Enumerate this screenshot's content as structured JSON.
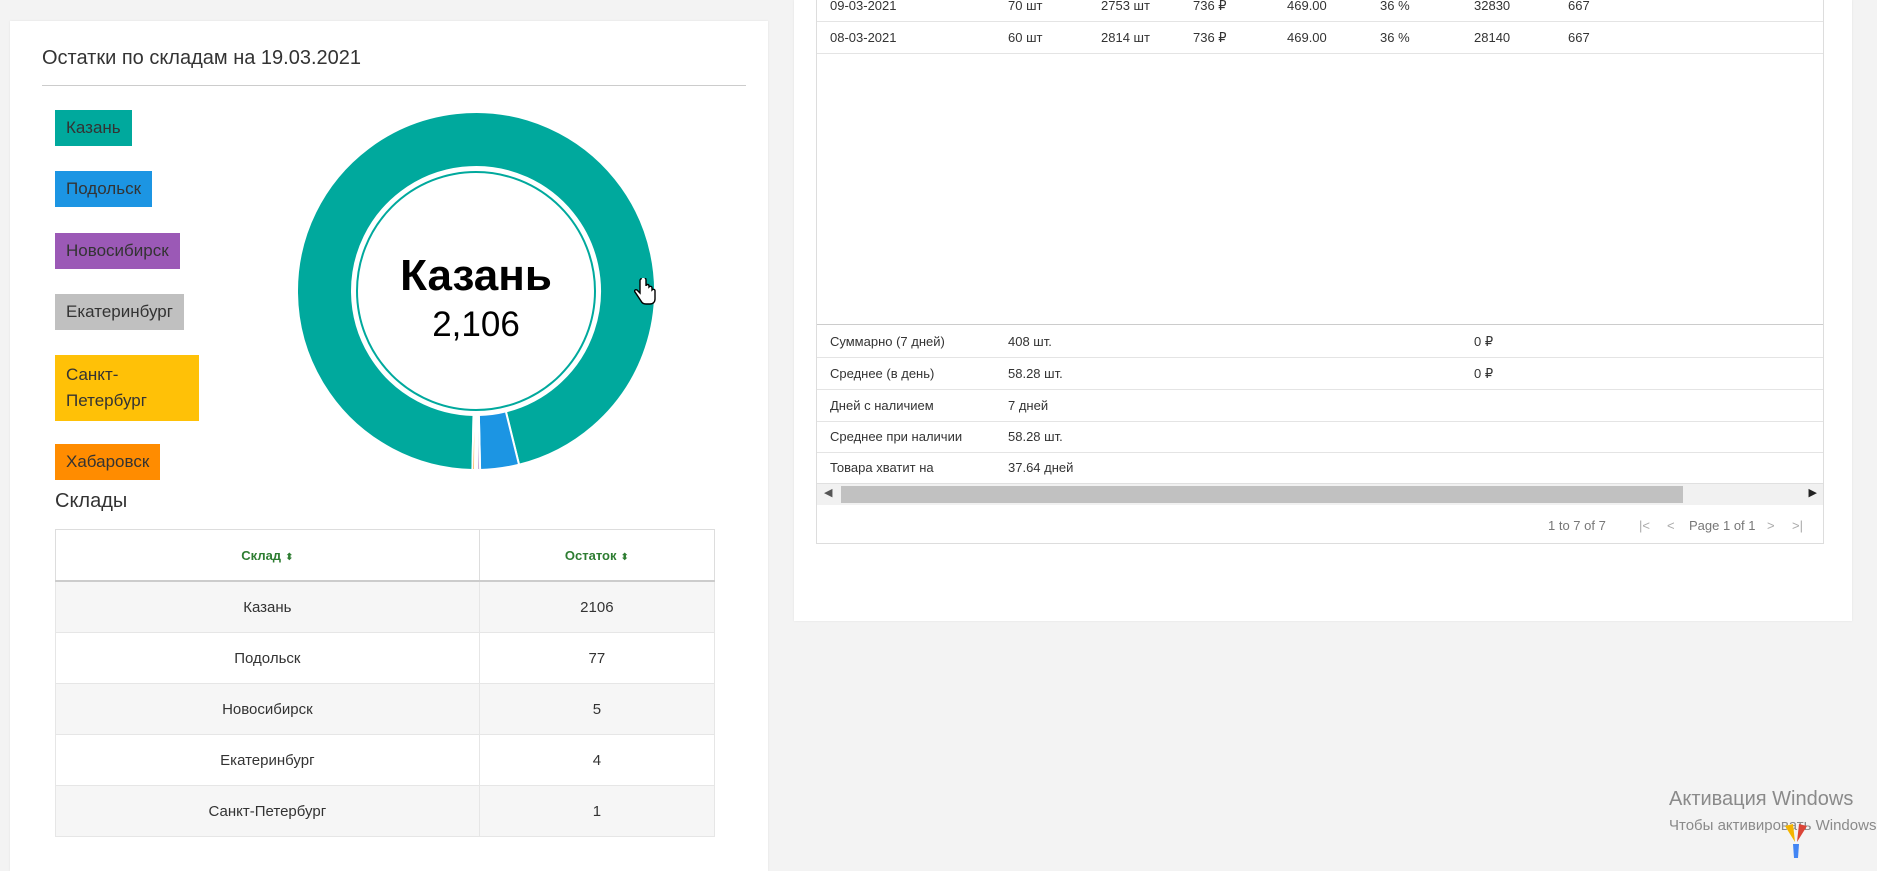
{
  "warehouses_card": {
    "title": "Остатки по складам на 19.03.2021",
    "legend": [
      {
        "label": "Казань",
        "color": "#00a99d"
      },
      {
        "label": "Подольск",
        "color": "#1c95e3"
      },
      {
        "label": "Новосибирск",
        "color": "#9b59b6"
      },
      {
        "label": "Екатеринбург",
        "color": "#c0c0c0"
      },
      {
        "label": "Санкт-Петербург",
        "color": "#ffc107"
      },
      {
        "label": "Хабаровск",
        "color": "#ff8c00"
      }
    ],
    "donut_center": {
      "name": "Казань",
      "value": "2,106"
    },
    "section_title": "Склады",
    "table": {
      "headers": [
        "Склад",
        "Остаток"
      ],
      "rows": [
        [
          "Казань",
          "2106"
        ],
        [
          "Подольск",
          "77"
        ],
        [
          "Новосибирск",
          "5"
        ],
        [
          "Екатеринбург",
          "4"
        ],
        [
          "Санкт-Петербург",
          "1"
        ]
      ]
    }
  },
  "chart_data": {
    "type": "pie",
    "labels": [
      "Казань",
      "Подольск",
      "Новосибирск",
      "Екатеринбург",
      "Санкт-Петербург",
      "Хабаровск"
    ],
    "values": [
      2106,
      77,
      5,
      4,
      1,
      5
    ],
    "colors": [
      "#00a99d",
      "#1c95e3",
      "#9b59b6",
      "#c0c0c0",
      "#ffc107",
      "#ff8c00"
    ],
    "center_label": "Казань",
    "center_value": "2,106"
  },
  "daily_table": {
    "rows": [
      [
        "09-03-2021",
        "70 шт",
        "2753 шт",
        "736 ₽",
        "469.00",
        "36 %",
        "32830",
        "667"
      ],
      [
        "08-03-2021",
        "60 шт",
        "2814 шт",
        "736 ₽",
        "469.00",
        "36 %",
        "28140",
        "667"
      ]
    ],
    "summary": [
      {
        "label": "Суммарно (7 дней)",
        "value": "408 шт.",
        "extra": "0 ₽"
      },
      {
        "label": "Среднее (в день)",
        "value": "58.28 шт.",
        "extra": "0 ₽"
      },
      {
        "label": "Дней с наличием",
        "value": "7 дней",
        "extra": ""
      },
      {
        "label": "Среднее при наличии",
        "value": "58.28 шт.",
        "extra": ""
      },
      {
        "label": "Товара хватит на",
        "value": "37.64 дней",
        "extra": ""
      }
    ],
    "pager": {
      "range_text": "1 to 7 of 7",
      "page_text": "Page 1 of 1"
    }
  },
  "watermark": {
    "line1": "Активация Windows",
    "line2": "Чтобы активировать Windows"
  }
}
